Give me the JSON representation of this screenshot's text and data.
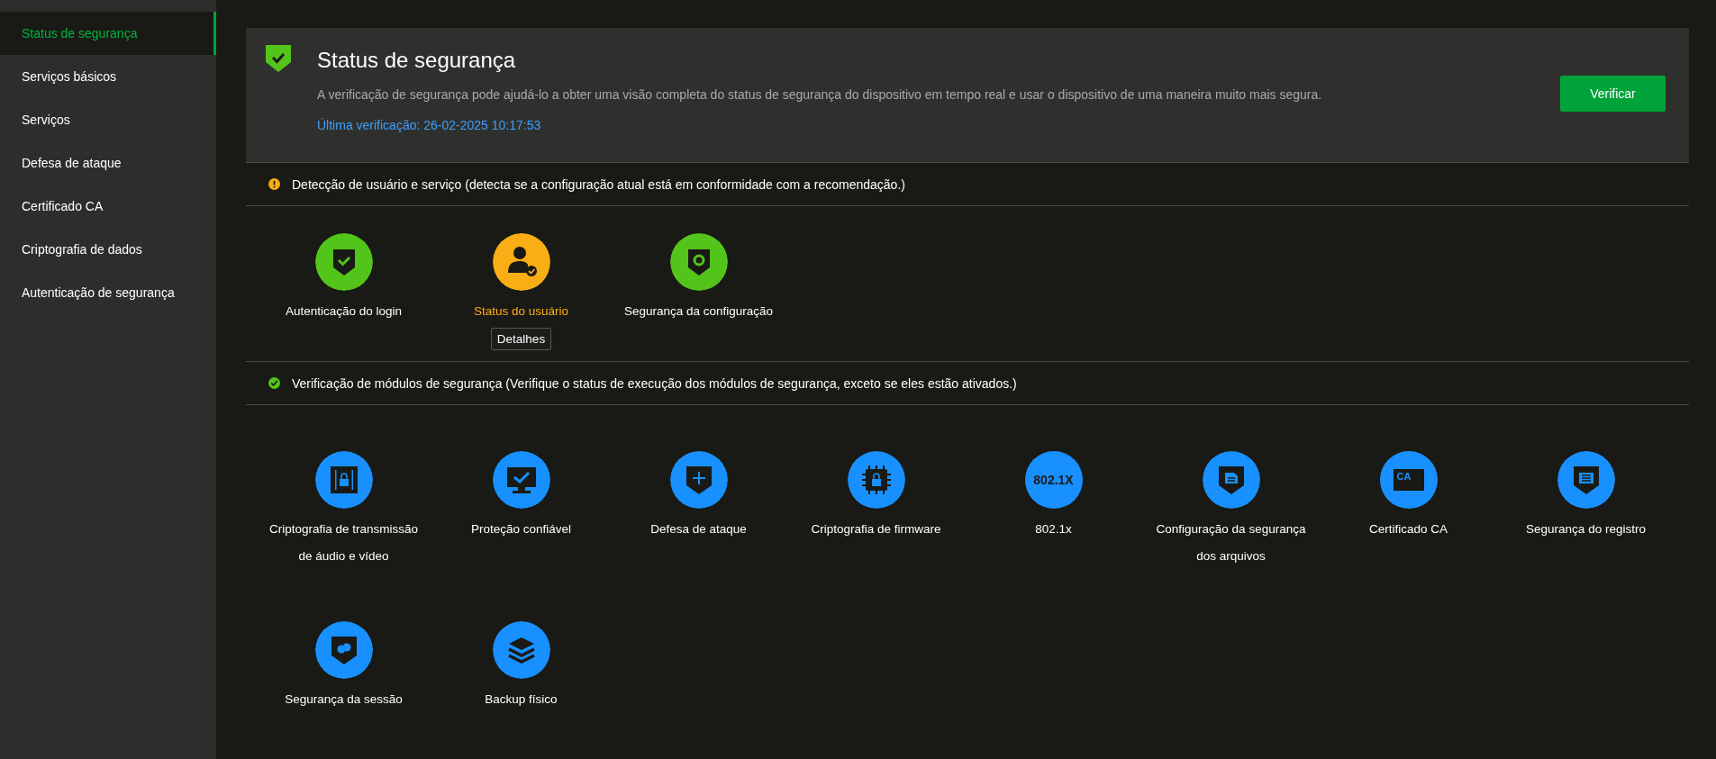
{
  "sidebar": {
    "items": [
      {
        "label": "Status de segurança",
        "selected": true
      },
      {
        "label": "Serviços básicos",
        "selected": false
      },
      {
        "label": "Serviços",
        "selected": false
      },
      {
        "label": "Defesa de ataque",
        "selected": false
      },
      {
        "label": "Certificado CA",
        "selected": false
      },
      {
        "label": "Criptografia de dados",
        "selected": false
      },
      {
        "label": "Autenticação de segurança",
        "selected": false
      }
    ]
  },
  "header": {
    "title": "Status de segurança",
    "description": "A verificação de segurança pode ajudá-lo a obter uma visão completa do status de segurança do dispositivo em tempo real e usar o dispositivo de uma maneira muito mais segura.",
    "last_check": "Última verificação: 26-02-2025 10:17:53",
    "button": "Verificar"
  },
  "user_service_detection": {
    "kind": "warning",
    "color": "#faad14",
    "heading": "Detecção de usuário e serviço (detecta se a configuração atual está em conformidade com a recomendação.)",
    "items": [
      {
        "label": "Autenticação do login",
        "color": "#52c41a",
        "highlighted": false
      },
      {
        "label": "Status do usuário",
        "color": "#faad14",
        "highlighted": true,
        "details_button": "Detalhes"
      },
      {
        "label": "Segurança da configuração",
        "color": "#52c41a",
        "highlighted": false
      }
    ]
  },
  "security_modules": {
    "kind": "check",
    "color": "#52c41a",
    "heading": "Verificação de módulos de segurança (Verifique o status de execução dos módulos de segurança, exceto se eles estão ativados.)",
    "items": [
      {
        "label": "Criptografia de transmissão de áudio e vídeo"
      },
      {
        "label": "Proteção confiável"
      },
      {
        "label": "Defesa de ataque"
      },
      {
        "label": "Criptografia de firmware"
      },
      {
        "label": "802.1x",
        "icon_text": "802.1X"
      },
      {
        "label": "Configuração da segurança dos arquivos"
      },
      {
        "label": "Certificado CA",
        "icon_text": "CA"
      },
      {
        "label": "Segurança do registro"
      },
      {
        "label": "Segurança da sessão"
      },
      {
        "label": "Backup físico"
      }
    ]
  }
}
